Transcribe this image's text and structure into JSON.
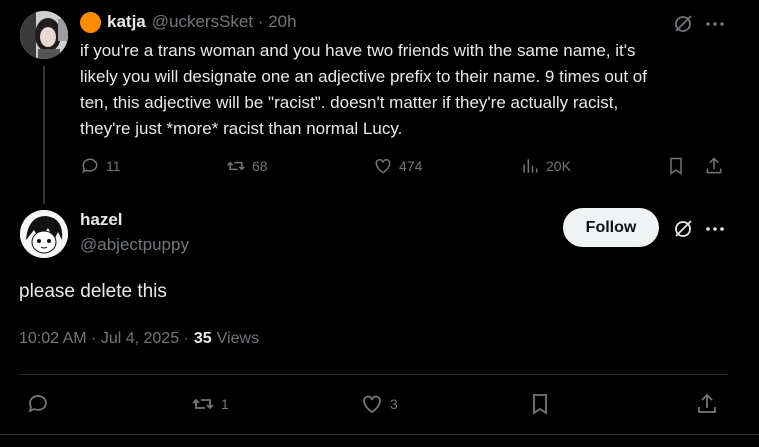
{
  "tweet1": {
    "display_name": "katja",
    "handle_time": "@uckersSket · 20h",
    "text_lines": [
      "if you're a trans woman and you have two friends with the same name, it's",
      "likely you will designate one an adjective prefix to their name. 9 times out of",
      "ten, this adjective will be \"racist\". doesn't matter if they're actually racist,",
      "they're just *more* racist than normal Lucy."
    ],
    "replies": "11",
    "reposts": "68",
    "likes": "474",
    "views": "20K",
    "badge_color": "#ff8c00"
  },
  "tweet2": {
    "display_name": "hazel",
    "handle": "@abjectpuppy",
    "follow_label": "Follow",
    "text": "please delete this",
    "time_date": "10:02 AM · Jul 4, 2025 ·",
    "views_count": "35",
    "views_label": "Views",
    "reposts": "1",
    "likes": "3"
  },
  "icons": [
    "grok-icon",
    "more-icon",
    "reply-icon",
    "repost-icon",
    "like-icon",
    "views-icon",
    "bookmark-icon",
    "share-icon"
  ]
}
